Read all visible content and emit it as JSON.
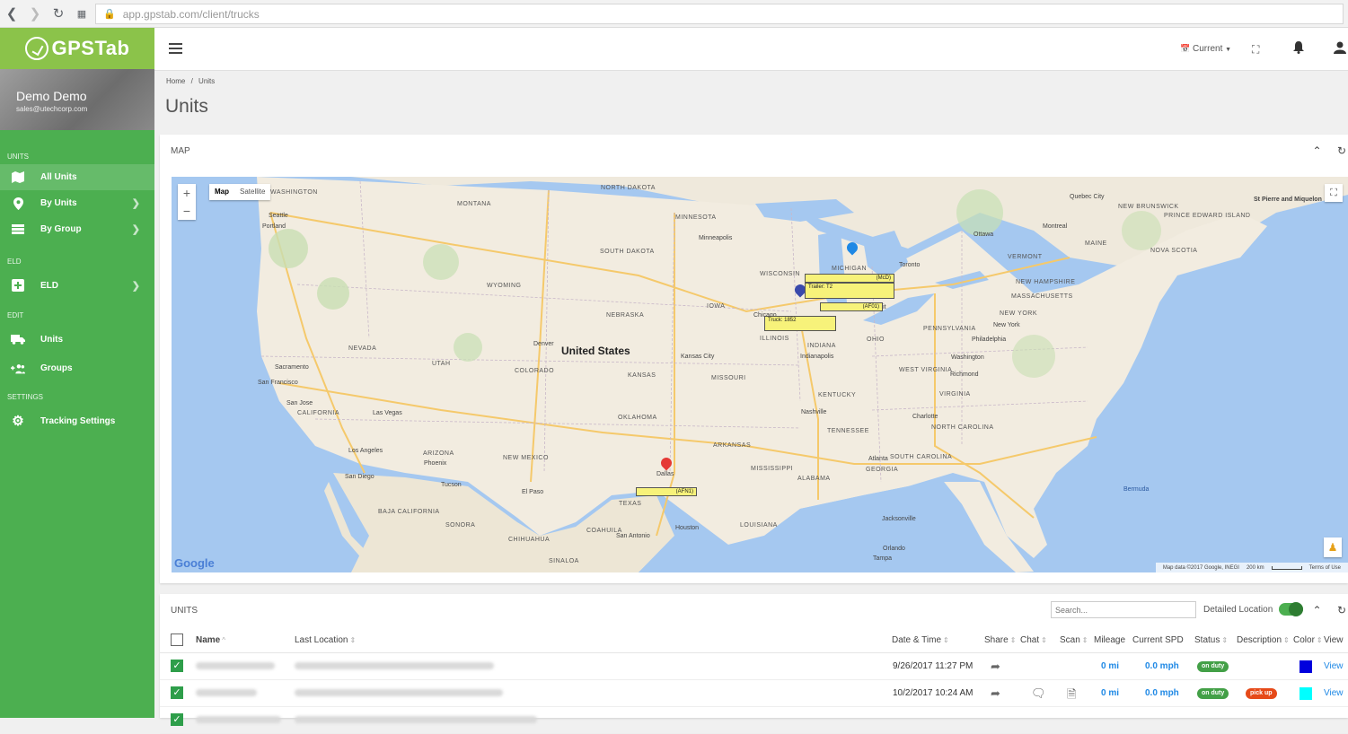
{
  "browser": {
    "url": "app.gpstab.com/client/trucks"
  },
  "logo": {
    "text": "GPSTab"
  },
  "profile": {
    "name": "Demo Demo",
    "email": "sales@utechcorp.com"
  },
  "sidebar": {
    "sections": [
      {
        "heading": "UNITS"
      },
      {
        "heading": "ELD"
      },
      {
        "heading": "EDIT"
      },
      {
        "heading": "SETTINGS"
      }
    ],
    "items": [
      {
        "label": "All Units",
        "icon": "map-icon"
      },
      {
        "label": "By Units",
        "icon": "location-pin-icon"
      },
      {
        "label": "By Group",
        "icon": "list-icon"
      },
      {
        "label": "ELD",
        "icon": "eld-icon"
      },
      {
        "label": "Units",
        "icon": "truck-icon"
      },
      {
        "label": "Groups",
        "icon": "add-group-icon"
      },
      {
        "label": "Tracking Settings",
        "icon": "gear-icon"
      }
    ]
  },
  "topbar": {
    "current_label": "Current"
  },
  "breadcrumb": {
    "home": "Home",
    "sep": "/",
    "current": "Units"
  },
  "page": {
    "title": "Units"
  },
  "map_card": {
    "title": "MAP",
    "map_types": [
      "Map",
      "Satellite"
    ],
    "zoom_in": "+",
    "zoom_out": "−",
    "attribution": "Map data ©2017 Google, INEGI",
    "scale": "200 km",
    "terms": "Terms of Use",
    "google": "Google",
    "labels": {
      "country": "United States",
      "states": [
        "WASHINGTON",
        "MONTANA",
        "NORTH DAKOTA",
        "MINNESOTA",
        "SOUTH DAKOTA",
        "WYOMING",
        "NEBRASKA",
        "IOWA",
        "NEVADA",
        "UTAH",
        "COLORADO",
        "KANSAS",
        "MISSOURI",
        "ILLINOIS",
        "INDIANA",
        "OHIO",
        "CALIFORNIA",
        "ARIZONA",
        "NEW MEXICO",
        "OKLAHOMA",
        "ARKANSAS",
        "TENNESSEE",
        "KENTUCKY",
        "WEST VIRGINIA",
        "VIRGINIA",
        "NORTH CAROLINA",
        "SOUTH CAROLINA",
        "GEORGIA",
        "ALABAMA",
        "MISSISSIPPI",
        "LOUISIANA",
        "TEXAS",
        "PENNSYLVANIA",
        "NEW YORK",
        "MAINE",
        "VERMONT",
        "NEW HAMPSHIRE",
        "MASSACHUSETTS",
        "NOVA SCOTIA",
        "NEW BRUNSWICK",
        "PRINCE EDWARD ISLAND",
        "SONORA",
        "CHIHUAHUA",
        "COAHUILA",
        "BAJA CALIFORNIA",
        "SINALOA",
        "MICHIGAN",
        "WISCONSIN"
      ],
      "cities": [
        "Seattle",
        "Portland",
        "Minneapolis",
        "Chicago",
        "Denver",
        "Kansas City",
        "Sacramento",
        "San Francisco",
        "San Jose",
        "Las Vegas",
        "Los Angeles",
        "San Diego",
        "Phoenix",
        "Tucson",
        "El Paso",
        "Dallas",
        "San Antonio",
        "Houston",
        "Nashville",
        "Atlanta",
        "Jacksonville",
        "Orlando",
        "Tampa",
        "Toronto",
        "Ottawa",
        "Montreal",
        "Quebec City",
        "New York",
        "Philadelphia",
        "Washington",
        "Richmond",
        "Charlotte",
        "Indianapolis",
        "Detroit"
      ],
      "water": [
        "Bermuda",
        "St Pierre and Miquelon"
      ]
    },
    "markers": [
      {
        "tag": "(McD)",
        "color": "#1e88e5"
      },
      {
        "tag": "Trailer: T2",
        "color": "#1e88e5"
      },
      {
        "tag": "(AF01)",
        "color": "#3949ab"
      },
      {
        "tag": "Truck: 1852",
        "color": "#3949ab"
      },
      {
        "tag": "(AFN1)",
        "color": "#e53935"
      }
    ]
  },
  "units_card": {
    "title": "UNITS",
    "search_placeholder": "Search...",
    "detailed_location_label": "Detailed Location",
    "columns": [
      "Name",
      "Last Location",
      "Date & Time",
      "Share",
      "Chat",
      "Scan",
      "Mileage",
      "Current SPD",
      "Status",
      "Description",
      "Color",
      "View"
    ],
    "rows": [
      {
        "datetime": "9/26/2017 11:27 PM",
        "mileage": "0 mi",
        "speed": "0.0 mph",
        "status": "on duty",
        "description": "",
        "color": "#0000dd",
        "view": "View"
      },
      {
        "datetime": "10/2/2017 10:24 AM",
        "mileage": "0 mi",
        "speed": "0.0 mph",
        "status": "on duty",
        "description": "pick up",
        "color": "#00ffff",
        "view": "View"
      }
    ]
  }
}
